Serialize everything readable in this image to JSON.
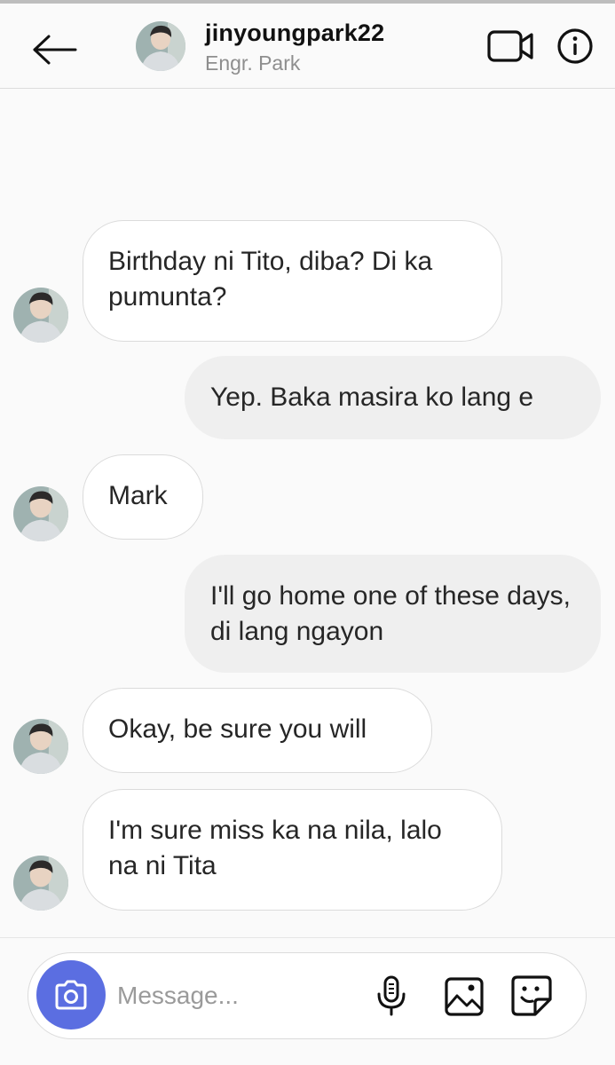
{
  "header": {
    "username": "jinyoungpark22",
    "subtitle": "Engr. Park",
    "icons": {
      "back": "arrow-left-icon",
      "video": "video-camera-icon",
      "info": "info-icon"
    }
  },
  "messages": [
    {
      "direction": "incoming",
      "text": "Birthday ni Tito, diba? Di ka pumunta?"
    },
    {
      "direction": "outgoing",
      "text": "Yep. Baka masira ko lang e"
    },
    {
      "direction": "incoming",
      "text": "Mark"
    },
    {
      "direction": "outgoing",
      "text": "I'll go home one of these days, di lang ngayon"
    },
    {
      "direction": "incoming",
      "text": "Okay, be sure you will"
    },
    {
      "direction": "incoming",
      "text": "I'm sure miss ka na nila, lalo na ni Tita"
    }
  ],
  "composer": {
    "placeholder": "Message...",
    "value": "",
    "icons": {
      "camera": "camera-icon",
      "mic": "microphone-icon",
      "gallery": "gallery-icon",
      "sticker": "sticker-icon"
    }
  },
  "colors": {
    "background": "#fafafa",
    "incoming_bubble": "#ffffff",
    "outgoing_bubble": "#efefef",
    "camera_button": "#5b6ee1",
    "text_primary": "#262626",
    "text_secondary": "#8e8e8e"
  }
}
